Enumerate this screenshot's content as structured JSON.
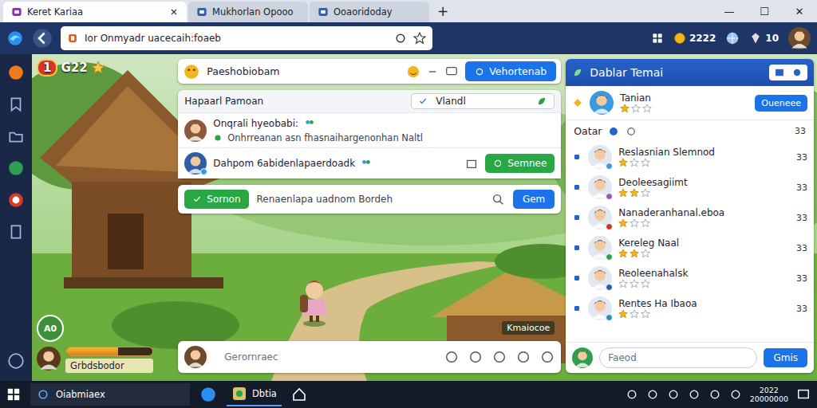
{
  "browser": {
    "tabs": [
      {
        "label": "Keret Kariaa",
        "selected": true
      },
      {
        "label": "Mukhorlan Opooo",
        "selected": false
      },
      {
        "label": "Ooaoridoday",
        "selected": false
      }
    ],
    "new_tab": "+",
    "window_controls": [
      "—",
      "☐",
      "✕"
    ],
    "url": "Ior Onmyadr uacecaih:foaeb",
    "coins": "2222",
    "count": "10"
  },
  "hud": {
    "level": "1",
    "score": "G22"
  },
  "chat": {
    "title": "Paeshobiobam",
    "button": "Vehortenab",
    "panel_title": "Hapaarl Pamoan",
    "filter": "Vlandl",
    "messages": [
      {
        "kind": "thread",
        "text": "Onqrali hyeobabi:",
        "subtext": "Onhrreanan asn fhasnaihargenonhan Naltl"
      },
      {
        "kind": "action",
        "text": "Dahpom 6abidenlapaerdoadk",
        "button": "Semnee"
      }
    ],
    "notice": {
      "button": "Sornon",
      "text": "Renaenlapa uadnom Bordeh",
      "action": "Gem"
    },
    "input": {
      "placeholder": "Gerornraec"
    }
  },
  "player": {
    "level": "A0",
    "name": "Grbdsbodor",
    "xp": 0.6
  },
  "scene_label": "Kmaiocoe",
  "friends": {
    "title": "Dablar Temai",
    "featured": {
      "name": "Tanian",
      "stars": 1,
      "button": "Oueneee"
    },
    "section": "Oatar",
    "section_count": "33",
    "items": [
      {
        "name": "Reslasnian Slemnod",
        "count": "33",
        "stars": 1,
        "color": "#3b9ae1"
      },
      {
        "name": "Deoleesagiimt",
        "count": "33",
        "stars": 2,
        "color": "#8e5bb5"
      },
      {
        "name": "Nanaderanhanal.eboa",
        "count": "33",
        "stars": 1,
        "color": "#c0392b"
      },
      {
        "name": "Kereleg Naal",
        "count": "33",
        "stars": 2,
        "color": "#2e9e4f"
      },
      {
        "name": "Reoleenahalsk",
        "count": "33",
        "stars": 0,
        "color": "#2d5fa8"
      },
      {
        "name": "Rentes Ha Ibaoa",
        "count": "33",
        "stars": 1,
        "color": "#2a8fb8"
      }
    ],
    "input": {
      "placeholder": "Faeod"
    },
    "send": "Gmis"
  },
  "taskbar": {
    "search": "Oiabmiaex",
    "apps": [
      {
        "label": "Dbtia",
        "selected": true
      }
    ],
    "clock": {
      "time": "2022",
      "date": "20000000"
    }
  }
}
